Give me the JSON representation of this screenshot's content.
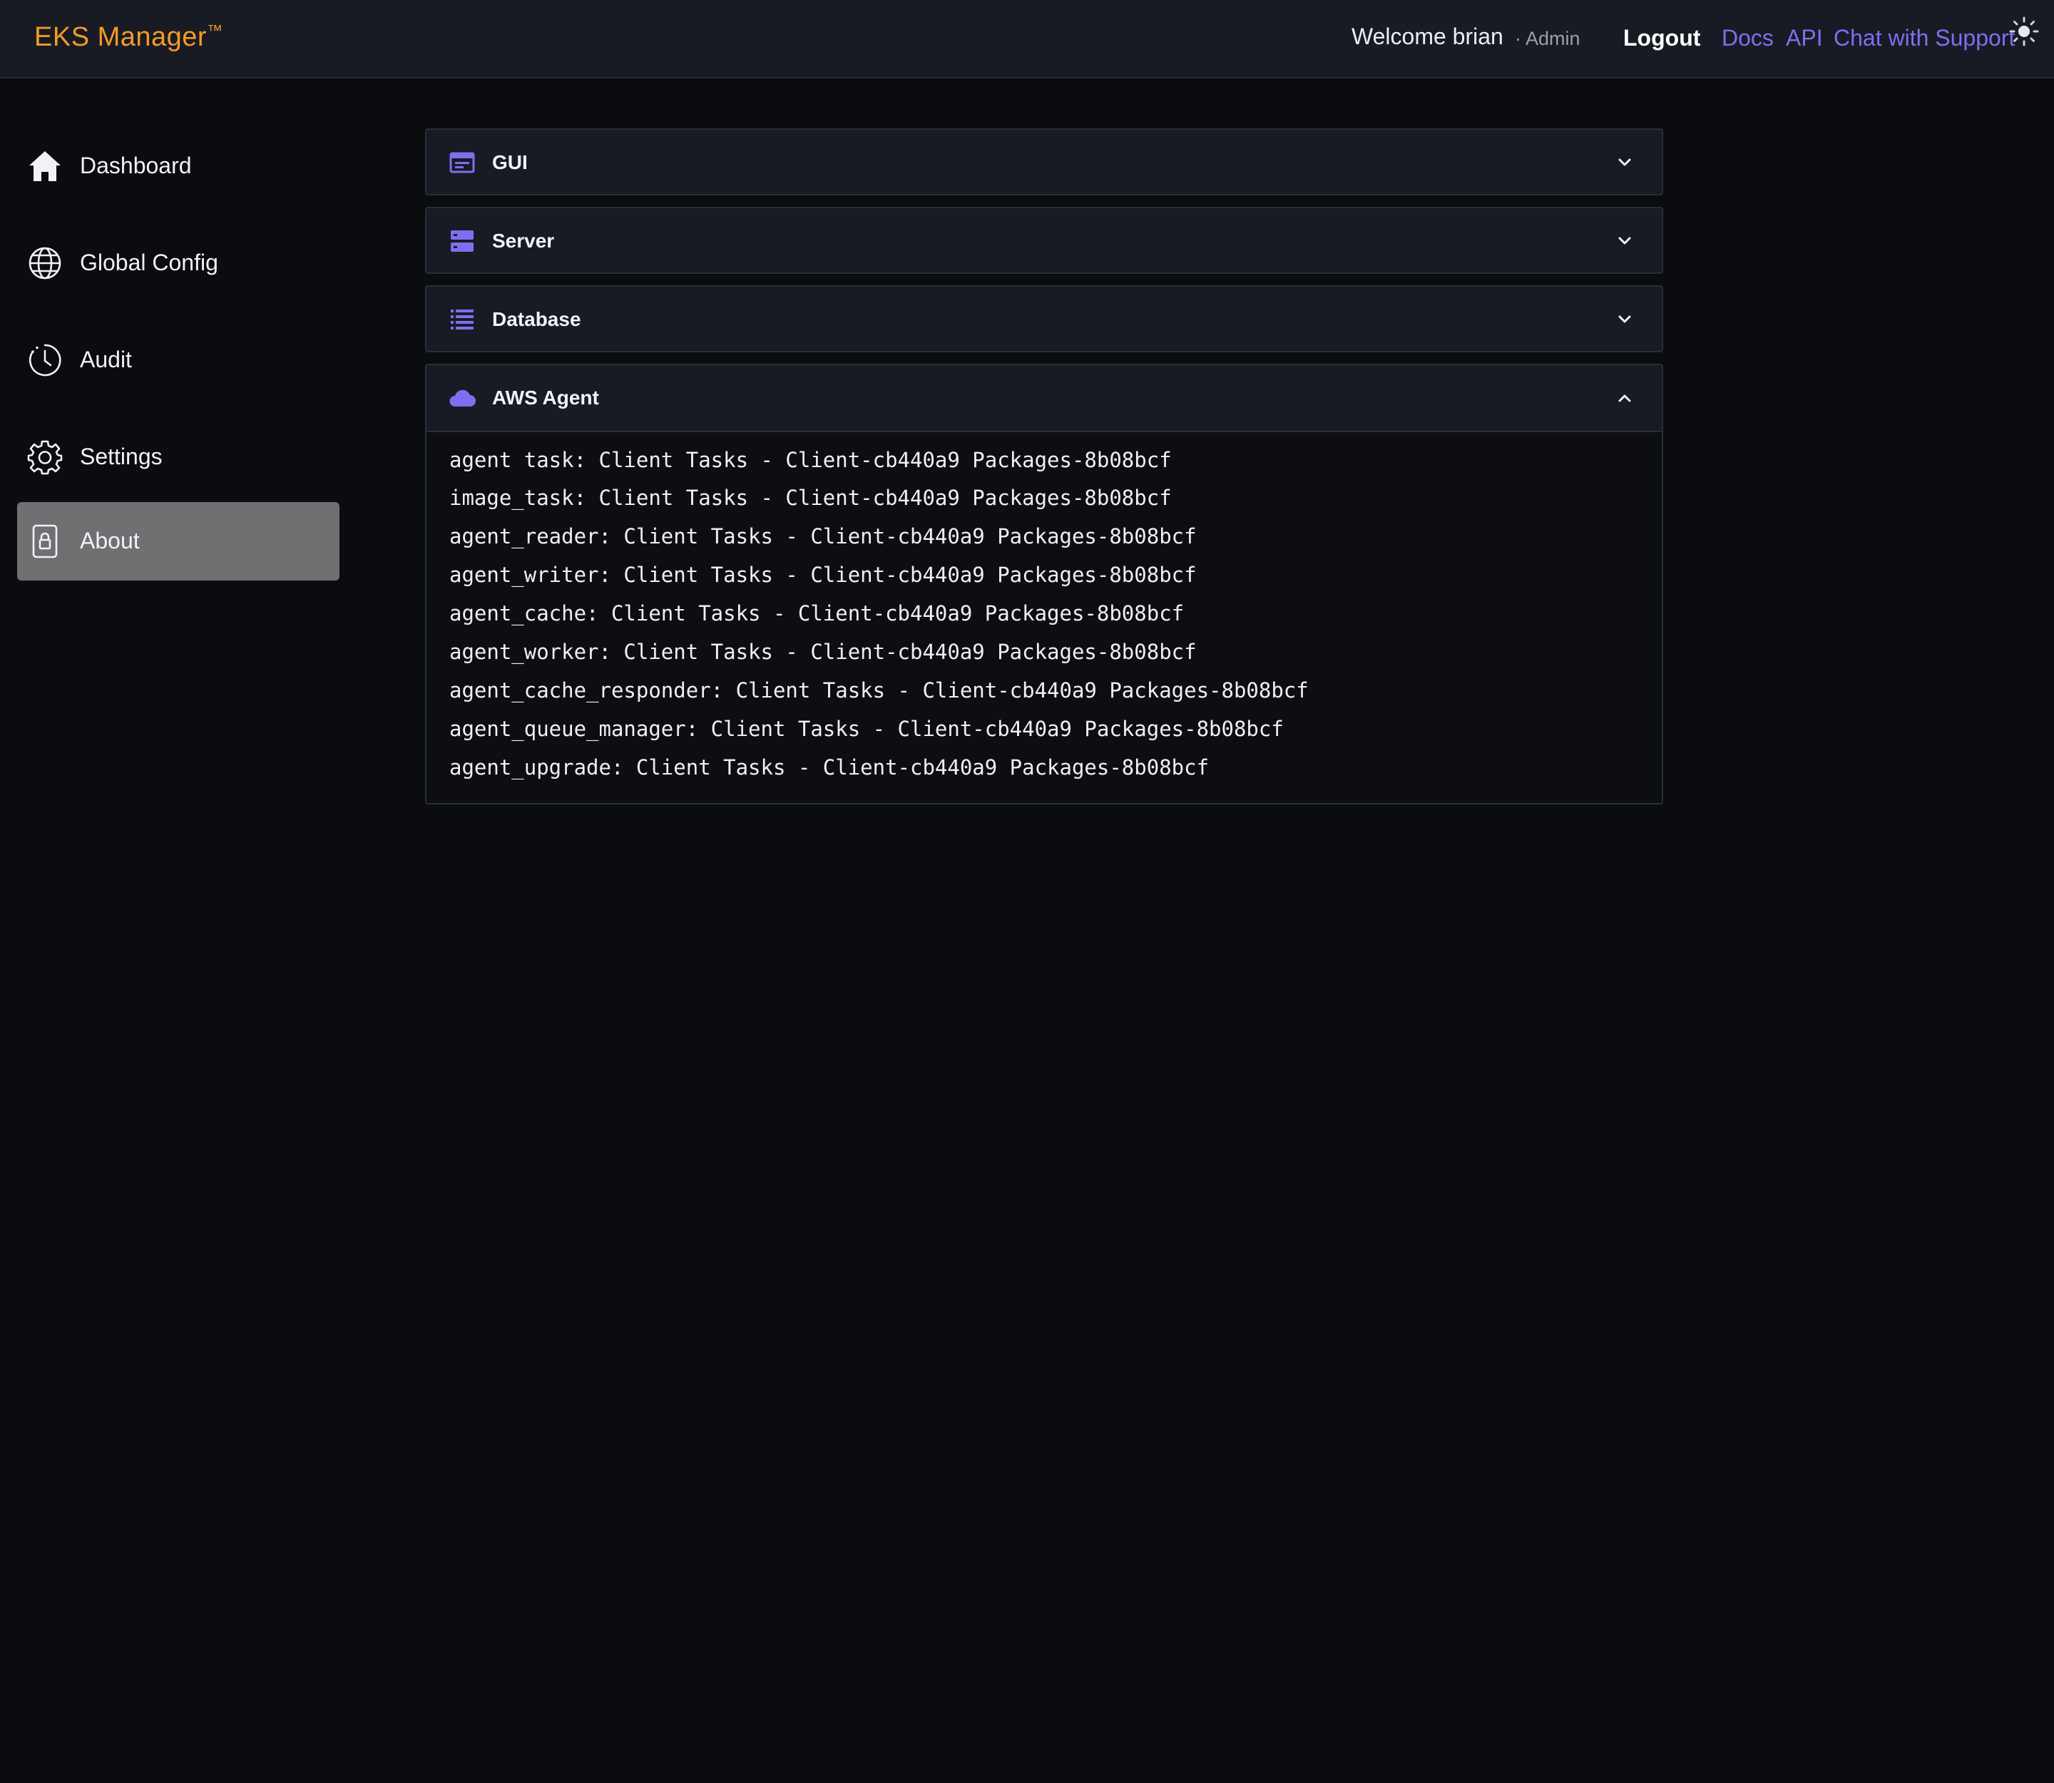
{
  "header": {
    "brand": "EKS Manager",
    "trademark": "™",
    "welcome": "Welcome brian",
    "role": "· Admin",
    "logout": "Logout",
    "links": [
      "Docs",
      "API",
      "Chat with Support"
    ],
    "theme_icon": "sun-icon",
    "colors": {
      "brand": "#f39a27",
      "link": "#7e6ff0"
    }
  },
  "sidebar": {
    "items": [
      {
        "label": "Dashboard",
        "icon": "home-icon",
        "active": false
      },
      {
        "label": "Global Config",
        "icon": "globe-icon",
        "active": false
      },
      {
        "label": "Audit",
        "icon": "clock-icon",
        "active": false
      },
      {
        "label": "Settings",
        "icon": "gear-icon",
        "active": false
      },
      {
        "label": "About",
        "icon": "lock-icon",
        "active": true
      }
    ]
  },
  "panels": [
    {
      "title": "GUI",
      "icon": "window-icon",
      "expanded": false
    },
    {
      "title": "Server",
      "icon": "server-icon",
      "expanded": false
    },
    {
      "title": "Database",
      "icon": "database-icon",
      "expanded": false
    },
    {
      "title": "AWS Agent",
      "icon": "cloud-icon",
      "expanded": true,
      "lines": [
        "agent task: Client Tasks - Client-cb440a9 Packages-8b08bcf",
        "image_task: Client Tasks - Client-cb440a9 Packages-8b08bcf",
        "agent_reader: Client Tasks - Client-cb440a9 Packages-8b08bcf",
        "agent_writer: Client Tasks - Client-cb440a9 Packages-8b08bcf",
        "agent_cache: Client Tasks - Client-cb440a9 Packages-8b08bcf",
        "agent_worker: Client Tasks - Client-cb440a9 Packages-8b08bcf",
        "agent_cache_responder: Client Tasks - Client-cb440a9 Packages-8b08bcf",
        "agent_queue_manager: Client Tasks - Client-cb440a9 Packages-8b08bcf",
        "agent_upgrade: Client Tasks - Client-cb440a9 Packages-8b08bcf"
      ]
    }
  ]
}
